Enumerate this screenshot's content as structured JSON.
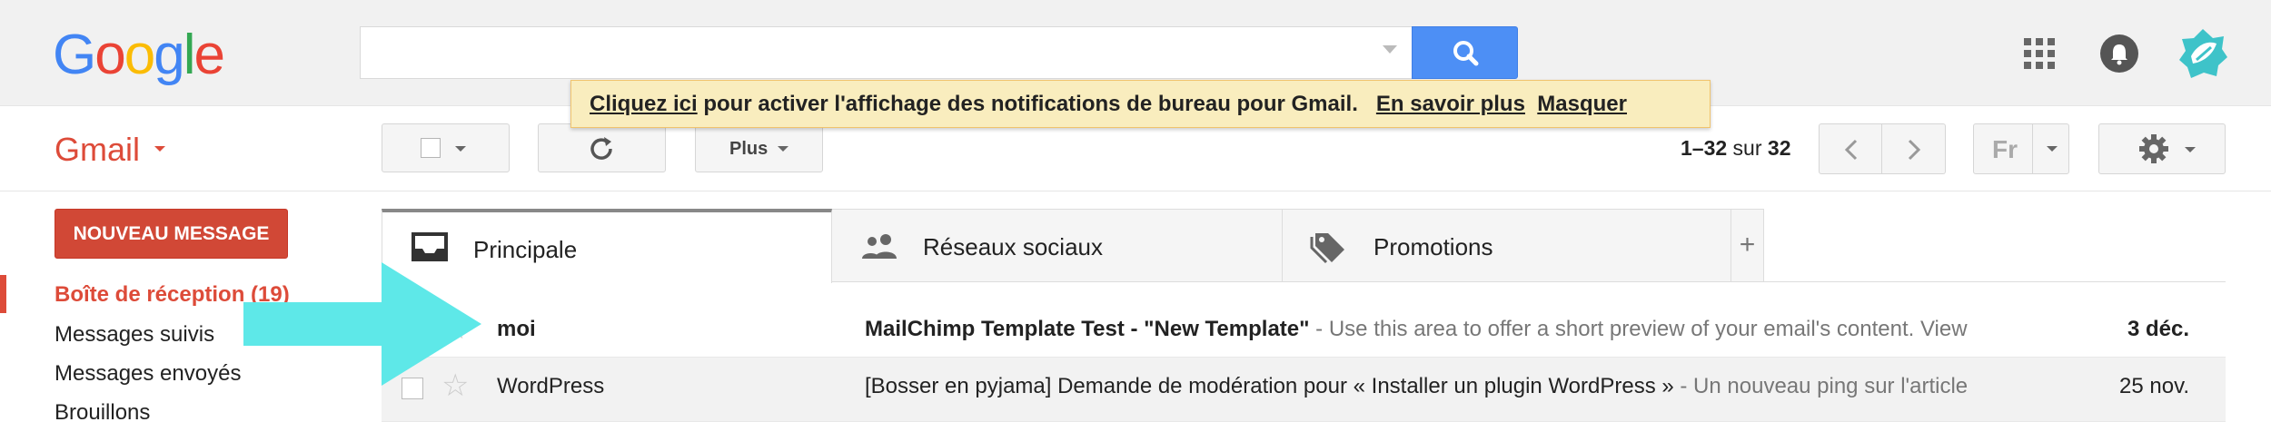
{
  "header": {
    "logo": [
      "G",
      "o",
      "o",
      "g",
      "l",
      "e"
    ],
    "logo_colors": [
      "#4285f4",
      "#ea4335",
      "#fbbc05",
      "#4285f4",
      "#34a853",
      "#ea4335"
    ],
    "search": {
      "value": "",
      "placeholder": ""
    }
  },
  "banner": {
    "link_activate": "Cliquez ici",
    "message": " pour activer l'affichage des notifications de bureau pour Gmail.",
    "link_learn_more": "En savoir plus",
    "link_dismiss": "Masquer"
  },
  "toolbar": {
    "app_label": "Gmail",
    "more_label": "Plus",
    "page_range": "1–32",
    "page_sep": " sur ",
    "page_total": "32",
    "language": "Fr"
  },
  "sidebar": {
    "compose_label": "NOUVEAU MESSAGE",
    "items": [
      {
        "label": "Boîte de réception (19)",
        "active": true
      },
      {
        "label": "Messages suivis"
      },
      {
        "label": "Messages envoyés"
      },
      {
        "label": "Brouillons"
      }
    ]
  },
  "tabs": [
    {
      "label": "Principale",
      "icon": "inbox-icon",
      "active": true
    },
    {
      "label": "Réseaux sociaux",
      "icon": "people-icon"
    },
    {
      "label": "Promotions",
      "icon": "tag-icon"
    }
  ],
  "messages": [
    {
      "sender": "moi",
      "subject": "MailChimp Template Test - \"New Template\"",
      "preview": " - Use this area to offer a short preview of your email's content. View",
      "date": "3 déc.",
      "unread": true
    },
    {
      "sender": "WordPress",
      "subject": "[Bosser en pyjama] Demande de modération pour « Installer un plugin WordPress »",
      "preview": " - Un nouveau ping sur l'article",
      "date": "25 nov.",
      "unread": false
    }
  ],
  "colors": {
    "accent_red": "#dd4b39",
    "compose_red": "#d14836",
    "search_blue": "#4d8ff5",
    "banner_yellow": "#f9edbe",
    "annotation_arrow": "#5ee8e8"
  }
}
